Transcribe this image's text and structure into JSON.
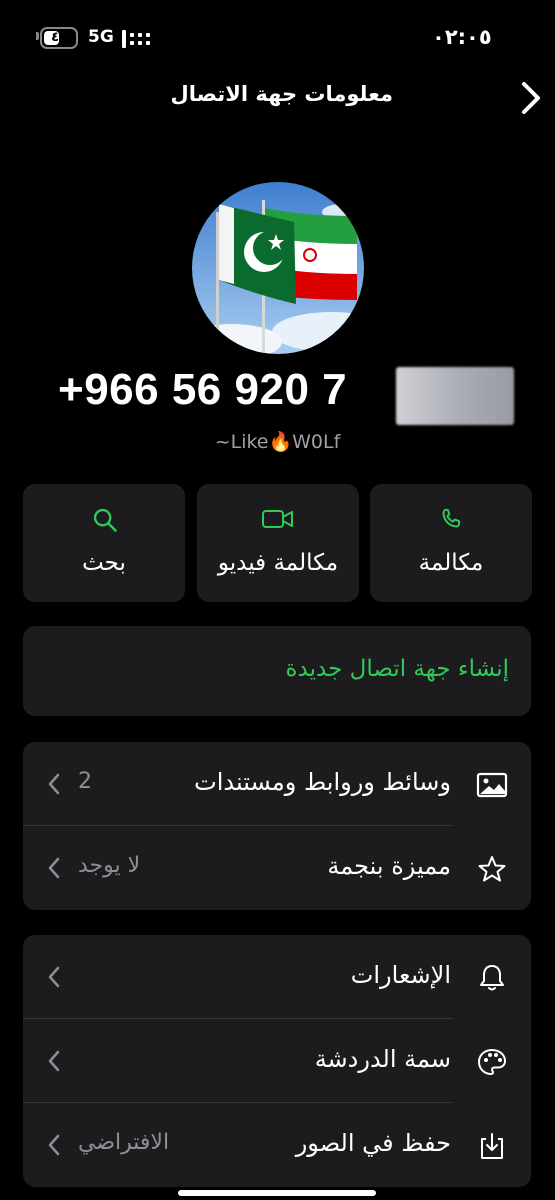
{
  "status_bar": {
    "battery_level": "٤٩",
    "battery_percent": 49,
    "network": "5G",
    "time": "٠٢:٠٥"
  },
  "header": {
    "title": "معلومات جهة الاتصال",
    "back_icon": "chevron-right-icon"
  },
  "contact": {
    "phone": "+966 56 920 7",
    "nickname": "~Like🔥W0Lf",
    "avatar": "flags-pakistan-iran"
  },
  "actions": [
    {
      "label": "مكالمة",
      "icon": "phone-icon"
    },
    {
      "label": "مكالمة فيديو",
      "icon": "video-icon"
    },
    {
      "label": "بحث",
      "icon": "search-icon"
    }
  ],
  "create_contact": {
    "label": "إنشاء جهة اتصال جديدة"
  },
  "media_section": [
    {
      "label": "وسائط وروابط ومستندات",
      "value": "2",
      "icon": "image-icon"
    },
    {
      "label": "مميزة بنجمة",
      "value": "لا يوجد",
      "icon": "star-icon"
    }
  ],
  "settings_section": [
    {
      "label": "الإشعارات",
      "value": "",
      "icon": "bell-icon"
    },
    {
      "label": "سمة الدردشة",
      "value": "",
      "icon": "palette-icon"
    },
    {
      "label": "حفظ في الصور",
      "value": "الافتراضي",
      "icon": "save-download-icon"
    }
  ],
  "colors": {
    "background": "#000000",
    "card": "#1c1c1e",
    "accent": "#34c759",
    "secondary_text": "#8e8e93"
  }
}
